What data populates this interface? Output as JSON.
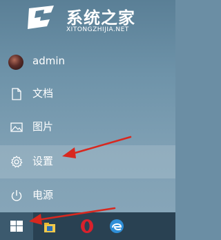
{
  "watermark": {
    "title": "系统之家",
    "subtitle": "XITONGZHIJIA.NET"
  },
  "start_menu": {
    "items": [
      {
        "label": "admin",
        "icon": "user-avatar"
      },
      {
        "label": "文档",
        "icon": "document-icon"
      },
      {
        "label": "图片",
        "icon": "picture-icon"
      },
      {
        "label": "设置",
        "icon": "gear-icon"
      },
      {
        "label": "电源",
        "icon": "power-icon"
      }
    ],
    "selected_index": 3
  },
  "taskbar": {
    "icons": [
      "windows-logo-icon",
      "file-explorer-icon",
      "opera-icon",
      "edge-icon"
    ]
  },
  "colors": {
    "menu_bg": "#6b8ea4",
    "taskbar_bg": "#294152",
    "arrow": "#d8281f",
    "opera_red": "#d9212c"
  }
}
